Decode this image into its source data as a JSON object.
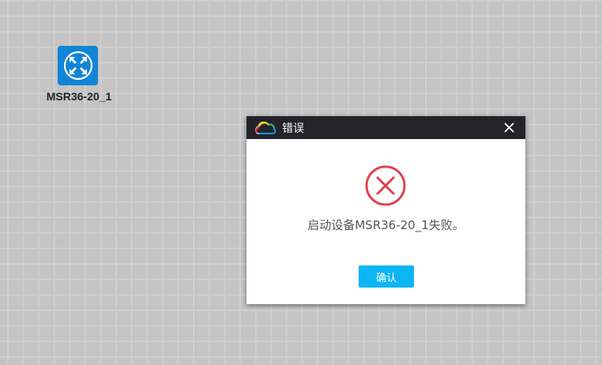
{
  "canvas": {
    "device": {
      "label": "MSR36-20_1",
      "icon": "router-arrows-icon",
      "icon_color": "#1185d6"
    }
  },
  "dialog": {
    "title": "错误",
    "logo_icon": "cloud-logo-icon",
    "close_icon": "close-icon",
    "error_icon": "error-x-circle-icon",
    "error_color": "#e0414f",
    "message": "启动设备MSR36-20_1失败。",
    "ok_label": "确认",
    "ok_color": "#0cb6f4",
    "titlebar_color": "#222429"
  }
}
